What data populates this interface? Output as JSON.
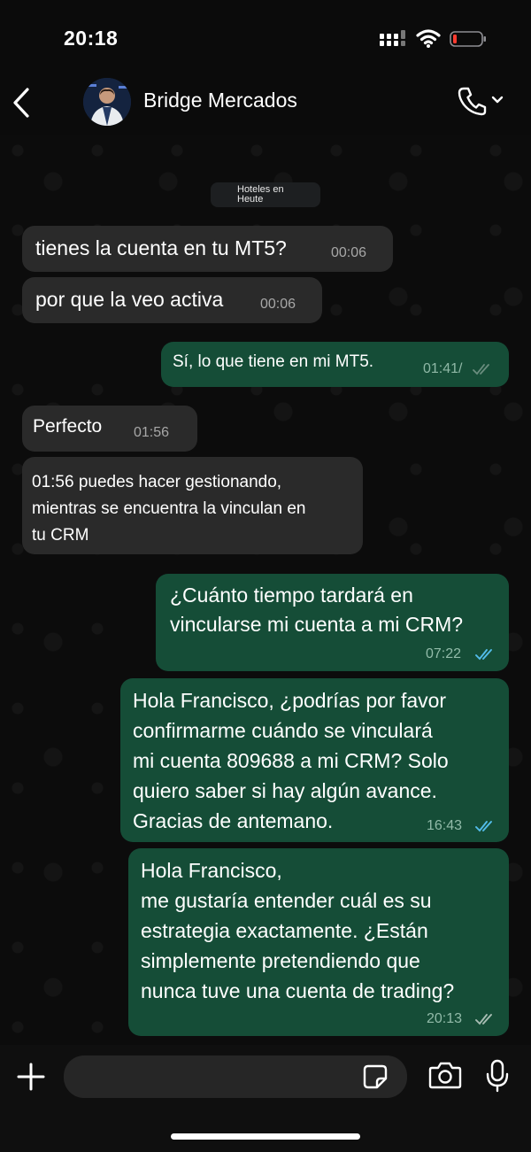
{
  "status_bar": {
    "time": "20:18"
  },
  "header": {
    "contact_name": "Bridge Mercados"
  },
  "date_chip": {
    "line1": "Hoteles en",
    "line2": "Heute"
  },
  "messages": [
    {
      "direction": "in",
      "text": "tienes la cuenta en tu MT5?",
      "time": "00:06"
    },
    {
      "direction": "in",
      "text": "por que la veo activa",
      "time": "00:06"
    },
    {
      "direction": "out",
      "text": "Sí, lo que tiene en mi MT5.",
      "time": "01:41/"
    },
    {
      "direction": "in",
      "text": "Perfecto",
      "time": "01:56"
    },
    {
      "direction": "in",
      "text": "01:56 puedes hacer gestionando,\nmientras se encuentra la vinculan en\ntu CRM",
      "time": ""
    },
    {
      "direction": "out",
      "text": "¿Cuánto tiempo tardará en\nvincularse mi cuenta a mi CRM?",
      "time": "07:22",
      "status": "read"
    },
    {
      "direction": "out",
      "text": "Hola Francisco, ¿podrías por favor\nconfirmarme cuándo se vinculará\nmi cuenta 809688 a mi CRM? Solo\nquiero saber si hay algún avance.\nGracias de antemano.",
      "time": "16:43",
      "status": "read"
    },
    {
      "direction": "out",
      "text": "Hola Francisco,\nme gustaría entender cuál es su\nestrategia exactamente. ¿Están\nsimplemente pretendiendo que\nnunca tuve una cuenta de trading?",
      "time": "20:13",
      "status": "delivered"
    }
  ],
  "composer": {
    "placeholder": ""
  },
  "icons": [
    "back-chevron-icon",
    "phone-icon",
    "chevron-down-icon",
    "plus-icon",
    "sticker-icon",
    "camera-icon",
    "microphone-icon",
    "double-check-icon"
  ],
  "colors": {
    "incoming_bubble": "#2a2a2a",
    "outgoing_bubble": "#154d37",
    "read_ticks": "#53bdeb",
    "battery_low": "#ff3b30"
  }
}
